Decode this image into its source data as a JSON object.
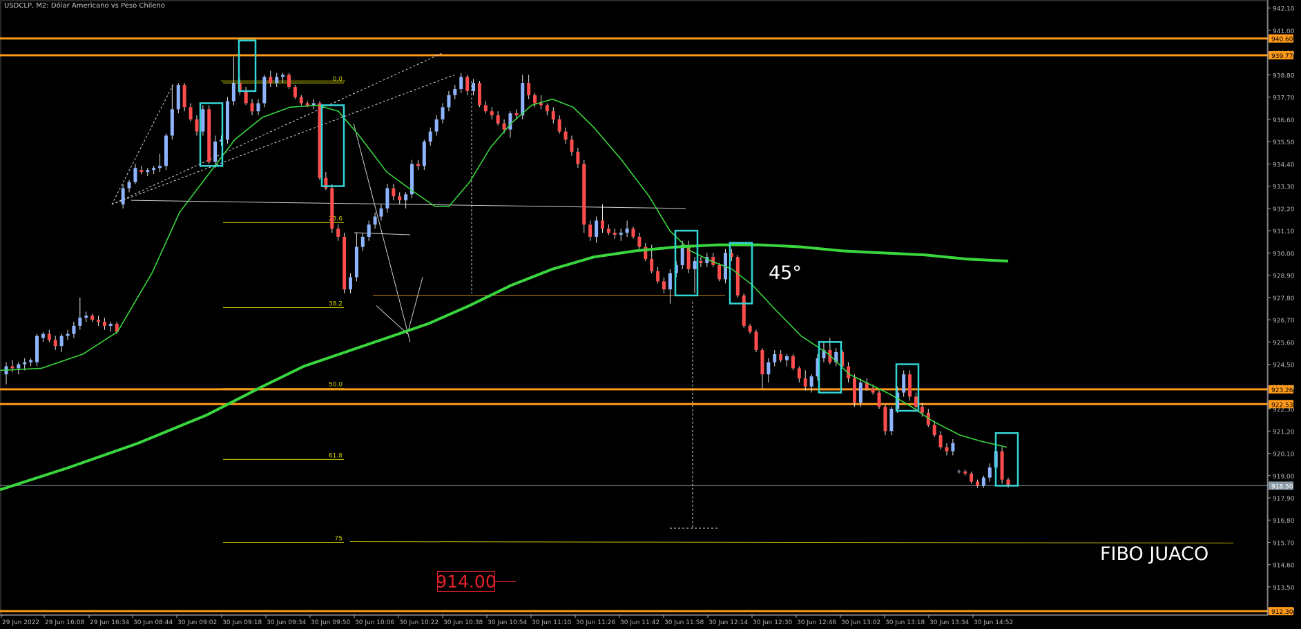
{
  "header": {
    "title": "USDCLP, M2:  Dólar Americano vs Peso Chileno"
  },
  "annotations": {
    "angle": "45°",
    "fibo_label": "FIBO JUACO",
    "target_price": "914.00"
  },
  "colors": {
    "background": "#000000",
    "bull_candle": "#8fb4ff",
    "bear_candle": "#ff4d4d",
    "level_line": "#ff9a1a",
    "fib_line": "#c8c800",
    "ma_line": "#39d63e",
    "highlight_box": "#35d6d6",
    "axis": "#b0b0b0"
  },
  "chart_data": {
    "type": "candlestick",
    "symbol": "USDCLP",
    "timeframe": "M2",
    "y_axis": {
      "ticks": [
        "942.10",
        "941.00",
        "939.90",
        "938.80",
        "937.70",
        "936.60",
        "935.50",
        "934.40",
        "933.30",
        "932.20",
        "931.10",
        "930.00",
        "928.90",
        "927.80",
        "926.70",
        "925.60",
        "924.50",
        "923.40",
        "922.30",
        "921.20",
        "920.10",
        "919.00",
        "917.90",
        "916.80",
        "915.70",
        "914.60",
        "913.50",
        "912.40"
      ],
      "range": [
        912.1,
        942.5
      ]
    },
    "x_axis": {
      "ticks": [
        "29 Jun 2022",
        "29 Jun 16:08",
        "29 Jun 16:34",
        "30 Jun 08:44",
        "30 Jun 09:02",
        "30 Jun 09:18",
        "30 Jun 09:34",
        "30 Jun 09:50",
        "30 Jun 10:06",
        "30 Jun 10:22",
        "30 Jun 10:38",
        "30 Jun 10:54",
        "30 Jun 11:10",
        "30 Jun 11:26",
        "30 Jun 11:42",
        "30 Jun 11:58",
        "30 Jun 12:14",
        "30 Jun 12:30",
        "30 Jun 12:46",
        "30 Jun 13:02",
        "30 Jun 13:18",
        "30 Jun 13:34",
        "30 Jun 14:52"
      ]
    },
    "price_labels": [
      {
        "value": "940.60",
        "price": 940.6
      },
      {
        "value": "939.77",
        "price": 939.77
      },
      {
        "value": "923.26",
        "price": 923.26
      },
      {
        "value": "922.53",
        "price": 922.53
      },
      {
        "value": "918.50",
        "price": 918.5
      },
      {
        "value": "912.30",
        "price": 912.3
      }
    ],
    "fibonacci_levels": [
      {
        "label": "0.0",
        "price": 938.4
      },
      {
        "label": "23.6",
        "price": 931.5
      },
      {
        "label": "38.2",
        "price": 927.3
      },
      {
        "label": "50.0",
        "price": 923.3
      },
      {
        "label": "61.8",
        "price": 919.8
      },
      {
        "label": "75",
        "price": 915.7
      }
    ],
    "candles": [
      {
        "o": 924.0,
        "h": 924.6,
        "l": 923.5,
        "c": 924.4
      },
      {
        "o": 924.4,
        "h": 924.7,
        "l": 924.1,
        "c": 924.3
      },
      {
        "o": 924.3,
        "h": 924.6,
        "l": 924.0,
        "c": 924.5
      },
      {
        "o": 924.5,
        "h": 924.8,
        "l": 924.2,
        "c": 924.6
      },
      {
        "o": 924.6,
        "h": 924.8,
        "l": 924.4,
        "c": 924.7
      },
      {
        "o": 924.6,
        "h": 926.0,
        "l": 924.4,
        "c": 925.9
      },
      {
        "o": 925.8,
        "h": 926.1,
        "l": 925.6,
        "c": 926.0
      },
      {
        "o": 926.0,
        "h": 926.2,
        "l": 925.6,
        "c": 925.7
      },
      {
        "o": 925.7,
        "h": 925.9,
        "l": 925.2,
        "c": 925.4
      },
      {
        "o": 925.4,
        "h": 926.0,
        "l": 925.1,
        "c": 925.9
      },
      {
        "o": 925.9,
        "h": 926.2,
        "l": 925.7,
        "c": 926.0
      },
      {
        "o": 926.0,
        "h": 926.6,
        "l": 925.8,
        "c": 926.4
      },
      {
        "o": 926.4,
        "h": 927.8,
        "l": 926.2,
        "c": 926.8
      },
      {
        "o": 926.8,
        "h": 927.1,
        "l": 926.6,
        "c": 926.9
      },
      {
        "o": 926.9,
        "h": 927.0,
        "l": 926.6,
        "c": 926.7
      },
      {
        "o": 926.7,
        "h": 926.9,
        "l": 926.4,
        "c": 926.6
      },
      {
        "o": 926.6,
        "h": 926.8,
        "l": 926.2,
        "c": 926.4
      },
      {
        "o": 926.4,
        "h": 926.6,
        "l": 926.1,
        "c": 926.5
      },
      {
        "o": 926.5,
        "h": 926.6,
        "l": 926.0,
        "c": 926.1
      },
      {
        "o": 932.4,
        "h": 933.4,
        "l": 932.2,
        "c": 933.2
      },
      {
        "o": 933.2,
        "h": 933.6,
        "l": 933.0,
        "c": 933.5
      },
      {
        "o": 933.5,
        "h": 934.4,
        "l": 933.4,
        "c": 934.2
      },
      {
        "o": 934.1,
        "h": 934.3,
        "l": 933.9,
        "c": 934.0
      },
      {
        "o": 934.0,
        "h": 934.2,
        "l": 933.8,
        "c": 934.1
      },
      {
        "o": 934.1,
        "h": 934.3,
        "l": 933.9,
        "c": 934.2
      },
      {
        "o": 934.2,
        "h": 934.9,
        "l": 934.0,
        "c": 934.3
      },
      {
        "o": 934.3,
        "h": 935.9,
        "l": 934.1,
        "c": 935.8
      },
      {
        "o": 935.8,
        "h": 938.3,
        "l": 935.6,
        "c": 937.1
      },
      {
        "o": 937.1,
        "h": 938.4,
        "l": 936.9,
        "c": 938.3
      },
      {
        "o": 938.3,
        "h": 938.4,
        "l": 937.0,
        "c": 937.2
      },
      {
        "o": 937.2,
        "h": 937.4,
        "l": 936.5,
        "c": 936.6
      },
      {
        "o": 936.6,
        "h": 936.8,
        "l": 935.8,
        "c": 936.0
      },
      {
        "o": 936.0,
        "h": 937.3,
        "l": 935.8,
        "c": 937.1
      },
      {
        "o": 937.1,
        "h": 937.3,
        "l": 934.4,
        "c": 934.5
      },
      {
        "o": 934.5,
        "h": 935.8,
        "l": 934.2,
        "c": 935.5
      },
      {
        "o": 935.5,
        "h": 935.8,
        "l": 935.3,
        "c": 935.6
      },
      {
        "o": 935.6,
        "h": 937.7,
        "l": 935.4,
        "c": 937.5
      },
      {
        "o": 937.5,
        "h": 939.7,
        "l": 937.3,
        "c": 938.4
      },
      {
        "o": 938.4,
        "h": 938.6,
        "l": 937.8,
        "c": 938.0
      },
      {
        "o": 938.0,
        "h": 938.2,
        "l": 937.3,
        "c": 937.4
      },
      {
        "o": 937.4,
        "h": 937.6,
        "l": 936.8,
        "c": 937.0
      },
      {
        "o": 937.0,
        "h": 937.6,
        "l": 936.8,
        "c": 937.4
      },
      {
        "o": 937.4,
        "h": 938.8,
        "l": 937.2,
        "c": 938.7
      },
      {
        "o": 938.7,
        "h": 939.0,
        "l": 938.2,
        "c": 938.4
      },
      {
        "o": 938.4,
        "h": 938.9,
        "l": 938.2,
        "c": 938.7
      },
      {
        "o": 938.7,
        "h": 938.9,
        "l": 938.4,
        "c": 938.8
      },
      {
        "o": 938.8,
        "h": 938.9,
        "l": 938.1,
        "c": 938.2
      },
      {
        "o": 938.2,
        "h": 938.3,
        "l": 937.6,
        "c": 937.7
      },
      {
        "o": 937.7,
        "h": 937.8,
        "l": 937.3,
        "c": 937.4
      },
      {
        "o": 937.4,
        "h": 937.5,
        "l": 937.2,
        "c": 937.3
      },
      {
        "o": 937.3,
        "h": 937.6,
        "l": 937.1,
        "c": 937.4
      },
      {
        "o": 937.4,
        "h": 937.5,
        "l": 933.6,
        "c": 933.7
      },
      {
        "o": 933.7,
        "h": 934.0,
        "l": 933.1,
        "c": 933.2
      },
      {
        "o": 933.2,
        "h": 933.4,
        "l": 931.0,
        "c": 931.2
      },
      {
        "o": 931.2,
        "h": 931.4,
        "l": 930.6,
        "c": 930.8
      },
      {
        "o": 930.8,
        "h": 931.0,
        "l": 928.0,
        "c": 928.2
      },
      {
        "o": 928.2,
        "h": 929.0,
        "l": 928.0,
        "c": 928.8
      },
      {
        "o": 928.8,
        "h": 931.0,
        "l": 928.6,
        "c": 930.3
      },
      {
        "o": 930.3,
        "h": 931.0,
        "l": 930.1,
        "c": 930.8
      },
      {
        "o": 930.8,
        "h": 931.6,
        "l": 930.6,
        "c": 931.4
      },
      {
        "o": 931.4,
        "h": 932.0,
        "l": 931.2,
        "c": 931.8
      },
      {
        "o": 931.8,
        "h": 932.4,
        "l": 931.6,
        "c": 932.2
      },
      {
        "o": 932.2,
        "h": 933.4,
        "l": 932.0,
        "c": 933.2
      },
      {
        "o": 933.2,
        "h": 933.4,
        "l": 932.6,
        "c": 932.8
      },
      {
        "o": 932.8,
        "h": 933.0,
        "l": 932.4,
        "c": 932.6
      },
      {
        "o": 932.6,
        "h": 933.0,
        "l": 932.2,
        "c": 932.9
      },
      {
        "o": 932.9,
        "h": 934.6,
        "l": 932.7,
        "c": 934.4
      },
      {
        "o": 934.4,
        "h": 934.6,
        "l": 934.1,
        "c": 934.3
      },
      {
        "o": 934.3,
        "h": 935.6,
        "l": 934.1,
        "c": 935.5
      },
      {
        "o": 935.5,
        "h": 936.2,
        "l": 935.3,
        "c": 936.0
      },
      {
        "o": 936.0,
        "h": 936.8,
        "l": 935.8,
        "c": 936.6
      },
      {
        "o": 936.6,
        "h": 937.4,
        "l": 936.4,
        "c": 937.2
      },
      {
        "o": 937.2,
        "h": 938.0,
        "l": 937.0,
        "c": 937.8
      },
      {
        "o": 937.8,
        "h": 938.3,
        "l": 937.6,
        "c": 938.1
      },
      {
        "o": 938.1,
        "h": 938.9,
        "l": 937.9,
        "c": 938.7
      },
      {
        "o": 938.7,
        "h": 938.8,
        "l": 937.8,
        "c": 938.0
      },
      {
        "o": 938.0,
        "h": 938.6,
        "l": 937.8,
        "c": 938.4
      },
      {
        "o": 938.4,
        "h": 938.5,
        "l": 937.2,
        "c": 937.3
      },
      {
        "o": 937.3,
        "h": 937.5,
        "l": 936.9,
        "c": 937.0
      },
      {
        "o": 937.0,
        "h": 937.2,
        "l": 936.6,
        "c": 936.8
      },
      {
        "o": 936.8,
        "h": 937.0,
        "l": 936.3,
        "c": 936.4
      },
      {
        "o": 936.4,
        "h": 936.6,
        "l": 935.9,
        "c": 936.1
      },
      {
        "o": 936.1,
        "h": 937.0,
        "l": 935.7,
        "c": 936.9
      },
      {
        "o": 936.9,
        "h": 937.1,
        "l": 936.6,
        "c": 936.8
      },
      {
        "o": 936.8,
        "h": 938.8,
        "l": 936.6,
        "c": 938.4
      },
      {
        "o": 938.4,
        "h": 938.8,
        "l": 937.6,
        "c": 937.8
      },
      {
        "o": 937.8,
        "h": 937.9,
        "l": 937.2,
        "c": 937.4
      },
      {
        "o": 937.4,
        "h": 937.8,
        "l": 937.1,
        "c": 937.3
      },
      {
        "o": 937.3,
        "h": 937.4,
        "l": 936.8,
        "c": 937.0
      },
      {
        "o": 937.0,
        "h": 937.2,
        "l": 936.4,
        "c": 936.6
      },
      {
        "o": 936.6,
        "h": 936.8,
        "l": 935.9,
        "c": 936.0
      },
      {
        "o": 936.0,
        "h": 936.2,
        "l": 935.4,
        "c": 935.6
      },
      {
        "o": 935.6,
        "h": 935.8,
        "l": 934.8,
        "c": 935.0
      },
      {
        "o": 935.0,
        "h": 935.2,
        "l": 934.2,
        "c": 934.4
      },
      {
        "o": 934.4,
        "h": 934.6,
        "l": 931.0,
        "c": 931.4
      },
      {
        "o": 931.4,
        "h": 931.6,
        "l": 930.6,
        "c": 930.8
      },
      {
        "o": 930.8,
        "h": 931.8,
        "l": 930.5,
        "c": 931.6
      },
      {
        "o": 931.6,
        "h": 932.4,
        "l": 931.0,
        "c": 931.2
      },
      {
        "o": 931.2,
        "h": 931.4,
        "l": 930.9,
        "c": 931.0
      },
      {
        "o": 931.0,
        "h": 931.2,
        "l": 930.7,
        "c": 930.9
      },
      {
        "o": 930.9,
        "h": 931.2,
        "l": 930.6,
        "c": 931.0
      },
      {
        "o": 931.0,
        "h": 931.6,
        "l": 930.8,
        "c": 931.2
      },
      {
        "o": 931.2,
        "h": 931.3,
        "l": 930.7,
        "c": 930.8
      },
      {
        "o": 930.8,
        "h": 931.0,
        "l": 930.2,
        "c": 930.3
      },
      {
        "o": 930.3,
        "h": 930.5,
        "l": 929.6,
        "c": 929.7
      },
      {
        "o": 929.7,
        "h": 930.4,
        "l": 929.0,
        "c": 929.1
      },
      {
        "o": 929.1,
        "h": 929.3,
        "l": 928.5,
        "c": 928.6
      },
      {
        "o": 928.6,
        "h": 928.8,
        "l": 928.0,
        "c": 928.2
      },
      {
        "o": 928.2,
        "h": 929.2,
        "l": 927.5,
        "c": 929.0
      },
      {
        "o": 929.0,
        "h": 929.6,
        "l": 928.8,
        "c": 929.4
      },
      {
        "o": 929.4,
        "h": 930.6,
        "l": 929.2,
        "c": 930.4
      },
      {
        "o": 930.4,
        "h": 930.6,
        "l": 929.0,
        "c": 929.2
      },
      {
        "o": 929.2,
        "h": 929.8,
        "l": 928.0,
        "c": 929.6
      },
      {
        "o": 929.6,
        "h": 929.8,
        "l": 929.3,
        "c": 929.5
      },
      {
        "o": 929.5,
        "h": 930.0,
        "l": 929.3,
        "c": 929.8
      },
      {
        "o": 929.8,
        "h": 930.0,
        "l": 929.3,
        "c": 929.4
      },
      {
        "o": 929.4,
        "h": 929.5,
        "l": 928.6,
        "c": 928.7
      },
      {
        "o": 928.7,
        "h": 930.2,
        "l": 928.5,
        "c": 930.0
      },
      {
        "o": 930.0,
        "h": 930.2,
        "l": 929.6,
        "c": 929.8
      },
      {
        "o": 929.8,
        "h": 929.9,
        "l": 927.8,
        "c": 927.9
      },
      {
        "o": 927.9,
        "h": 928.0,
        "l": 926.3,
        "c": 926.4
      },
      {
        "o": 926.4,
        "h": 926.5,
        "l": 926.0,
        "c": 926.1
      },
      {
        "o": 926.1,
        "h": 926.2,
        "l": 925.1,
        "c": 925.2
      },
      {
        "o": 925.2,
        "h": 925.3,
        "l": 923.3,
        "c": 924.0
      },
      {
        "o": 924.0,
        "h": 924.8,
        "l": 923.6,
        "c": 924.6
      },
      {
        "o": 924.6,
        "h": 925.2,
        "l": 924.4,
        "c": 925.0
      },
      {
        "o": 925.0,
        "h": 925.2,
        "l": 924.6,
        "c": 924.7
      },
      {
        "o": 924.7,
        "h": 925.0,
        "l": 924.4,
        "c": 924.9
      },
      {
        "o": 924.9,
        "h": 925.0,
        "l": 924.2,
        "c": 924.3
      },
      {
        "o": 924.3,
        "h": 924.4,
        "l": 923.6,
        "c": 923.8
      },
      {
        "o": 923.8,
        "h": 924.2,
        "l": 923.2,
        "c": 923.4
      },
      {
        "o": 923.4,
        "h": 924.0,
        "l": 923.1,
        "c": 923.9
      },
      {
        "o": 923.9,
        "h": 925.0,
        "l": 923.7,
        "c": 924.8
      },
      {
        "o": 924.8,
        "h": 925.6,
        "l": 924.6,
        "c": 925.2
      },
      {
        "o": 925.2,
        "h": 925.8,
        "l": 924.5,
        "c": 924.6
      },
      {
        "o": 924.6,
        "h": 925.3,
        "l": 924.4,
        "c": 925.1
      },
      {
        "o": 925.1,
        "h": 925.2,
        "l": 924.3,
        "c": 924.4
      },
      {
        "o": 924.4,
        "h": 924.6,
        "l": 923.6,
        "c": 923.8
      },
      {
        "o": 923.8,
        "h": 924.0,
        "l": 922.4,
        "c": 922.6
      },
      {
        "o": 922.6,
        "h": 923.8,
        "l": 922.4,
        "c": 923.6
      },
      {
        "o": 923.6,
        "h": 923.8,
        "l": 923.2,
        "c": 923.3
      },
      {
        "o": 923.3,
        "h": 923.5,
        "l": 923.0,
        "c": 923.1
      },
      {
        "o": 923.1,
        "h": 923.2,
        "l": 922.3,
        "c": 922.4
      },
      {
        "o": 922.4,
        "h": 922.5,
        "l": 921.0,
        "c": 921.2
      },
      {
        "o": 921.2,
        "h": 922.4,
        "l": 921.0,
        "c": 922.3
      },
      {
        "o": 922.3,
        "h": 923.4,
        "l": 922.1,
        "c": 923.1
      },
      {
        "o": 923.1,
        "h": 924.2,
        "l": 922.9,
        "c": 924.0
      },
      {
        "o": 924.0,
        "h": 924.2,
        "l": 922.7,
        "c": 922.9
      },
      {
        "o": 922.9,
        "h": 923.1,
        "l": 922.2,
        "c": 922.4
      },
      {
        "o": 922.4,
        "h": 922.6,
        "l": 921.9,
        "c": 922.1
      },
      {
        "o": 922.1,
        "h": 922.3,
        "l": 921.4,
        "c": 921.5
      },
      {
        "o": 921.5,
        "h": 921.7,
        "l": 920.9,
        "c": 921.0
      },
      {
        "o": 921.0,
        "h": 921.2,
        "l": 920.3,
        "c": 920.4
      },
      {
        "o": 920.4,
        "h": 920.6,
        "l": 920.0,
        "c": 920.2
      },
      {
        "o": 920.2,
        "h": 920.8,
        "l": 920.0,
        "c": 920.6
      },
      {
        "o": 919.2,
        "h": 919.3,
        "l": 919.1,
        "c": 919.2
      },
      {
        "o": 919.2,
        "h": 919.3,
        "l": 919.0,
        "c": 919.1
      },
      {
        "o": 919.1,
        "h": 919.2,
        "l": 918.6,
        "c": 918.7
      },
      {
        "o": 918.7,
        "h": 918.8,
        "l": 918.4,
        "c": 918.5
      },
      {
        "o": 918.5,
        "h": 919.0,
        "l": 918.4,
        "c": 918.9
      },
      {
        "o": 918.9,
        "h": 919.6,
        "l": 918.7,
        "c": 919.4
      },
      {
        "o": 919.4,
        "h": 920.4,
        "l": 919.2,
        "c": 920.2
      },
      {
        "o": 920.2,
        "h": 920.4,
        "l": 918.6,
        "c": 918.8
      },
      {
        "o": 918.8,
        "h": 918.9,
        "l": 918.4,
        "c": 918.5
      }
    ]
  }
}
